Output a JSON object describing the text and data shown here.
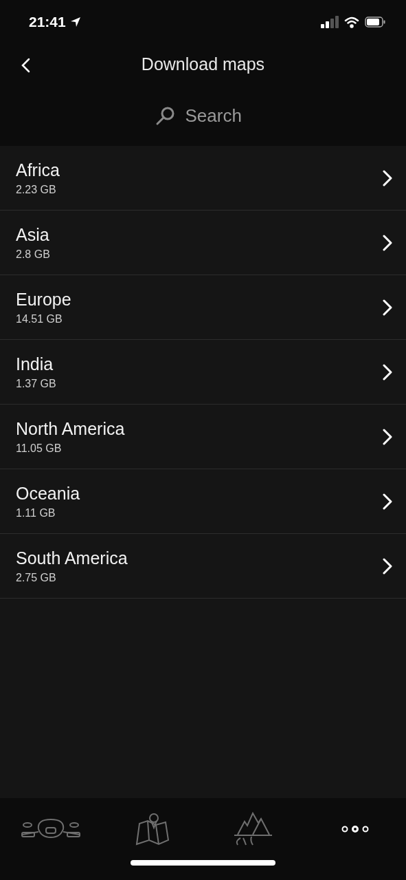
{
  "status_bar": {
    "time": "21:41"
  },
  "header": {
    "title": "Download maps"
  },
  "search": {
    "placeholder": "Search"
  },
  "regions": [
    {
      "name": "Africa",
      "size": "2.23 GB"
    },
    {
      "name": "Asia",
      "size": "2.8 GB"
    },
    {
      "name": "Europe",
      "size": "14.51 GB"
    },
    {
      "name": "India",
      "size": "1.37 GB"
    },
    {
      "name": "North America",
      "size": "11.05 GB"
    },
    {
      "name": "Oceania",
      "size": "1.11 GB"
    },
    {
      "name": "South America",
      "size": "2.75 GB"
    }
  ],
  "tab_bar": [
    {
      "kind": "scooter",
      "selected": false
    },
    {
      "kind": "map",
      "selected": false
    },
    {
      "kind": "mountains",
      "selected": false
    },
    {
      "kind": "more",
      "selected": true
    }
  ]
}
